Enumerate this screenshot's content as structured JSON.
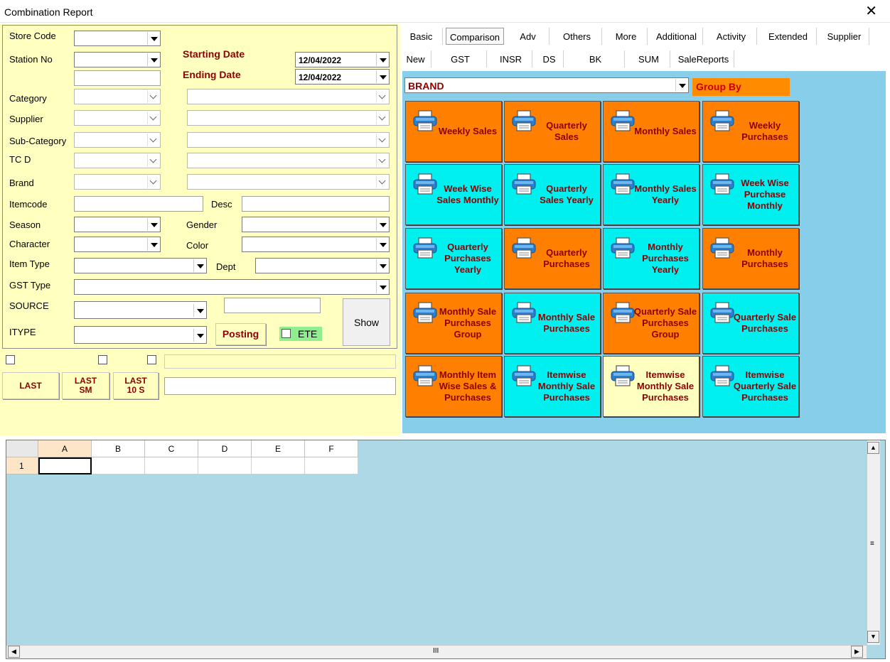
{
  "window": {
    "title": "Combination Report"
  },
  "filters": {
    "store_code": "Store Code",
    "station_no": "Station No",
    "starting_date_label": "Starting Date",
    "ending_date_label": "Ending Date",
    "starting_date": "12/04/2022",
    "ending_date": "12/04/2022",
    "category": "Category",
    "supplier": "Supplier",
    "sub_category": "Sub-Category",
    "tcd": "TC D",
    "brand": "Brand",
    "itemcode": "Itemcode",
    "desc": "Desc",
    "season": "Season",
    "gender": "Gender",
    "character": "Character",
    "color": "Color",
    "item_type": "Item Type",
    "dept": "Dept",
    "gst_type": "GST Type",
    "source": "SOURCE",
    "itype": "ITYPE",
    "posting": "Posting",
    "ete": "ETE",
    "show": "Show"
  },
  "quick_buttons": {
    "last": "LAST",
    "last_sm": "LAST SM",
    "last_10s": "LAST 10 S"
  },
  "tabs_row1": [
    "Basic",
    "Comparison",
    "Adv",
    "Others",
    "More",
    "Additional",
    "Activity",
    "Extended",
    "Supplier"
  ],
  "tabs_row2": [
    "New",
    "GST",
    "INSR",
    "DS",
    "BK",
    "SUM",
    "SaleReports"
  ],
  "group": {
    "selected": "BRAND",
    "label": "Group By"
  },
  "report_buttons": [
    {
      "label": "Weekly Sales",
      "color": "orange"
    },
    {
      "label": "Quarterly Sales",
      "color": "orange"
    },
    {
      "label": "Monthly Sales",
      "color": "orange"
    },
    {
      "label": "Weekly Purchases",
      "color": "orange"
    },
    {
      "label": "Week Wise Sales Monthly",
      "color": "cyan"
    },
    {
      "label": "Quarterly Sales Yearly",
      "color": "cyan"
    },
    {
      "label": "Monthly Sales Yearly",
      "color": "cyan"
    },
    {
      "label": "Week Wise Purchase Monthly",
      "color": "cyan"
    },
    {
      "label": "Quarterly Purchases Yearly",
      "color": "cyan"
    },
    {
      "label": "Quarterly Purchases",
      "color": "orange"
    },
    {
      "label": "Monthly Purchases Yearly",
      "color": "cyan"
    },
    {
      "label": "Monthly Purchases",
      "color": "orange"
    },
    {
      "label": "Monthly Sale Purchases Group",
      "color": "orange"
    },
    {
      "label": "Monthly Sale Purchases",
      "color": "cyan"
    },
    {
      "label": "Quarterly Sale Purchases Group",
      "color": "orange"
    },
    {
      "label": "Quarterly Sale Purchases",
      "color": "cyan"
    },
    {
      "label": "Monthly Item Wise Sales & Purchases",
      "color": "orange"
    },
    {
      "label": "Itemwise Monthly Sale Purchases",
      "color": "cyan"
    },
    {
      "label": "Itemwise Monthly Sale Purchases",
      "color": "cream"
    },
    {
      "label": "Itemwise Quarterly Sale Purchases",
      "color": "cyan"
    }
  ],
  "sheet": {
    "columns": [
      "A",
      "B",
      "C",
      "D",
      "E",
      "F"
    ],
    "rows": [
      "1"
    ]
  },
  "colors": {
    "panel": "#ffffc0",
    "orange": "#ff8000",
    "cyan": "#00f0f0",
    "report_bg": "#87ceeb",
    "sheet_bg": "#add8e6",
    "label_red": "#8b0000"
  }
}
